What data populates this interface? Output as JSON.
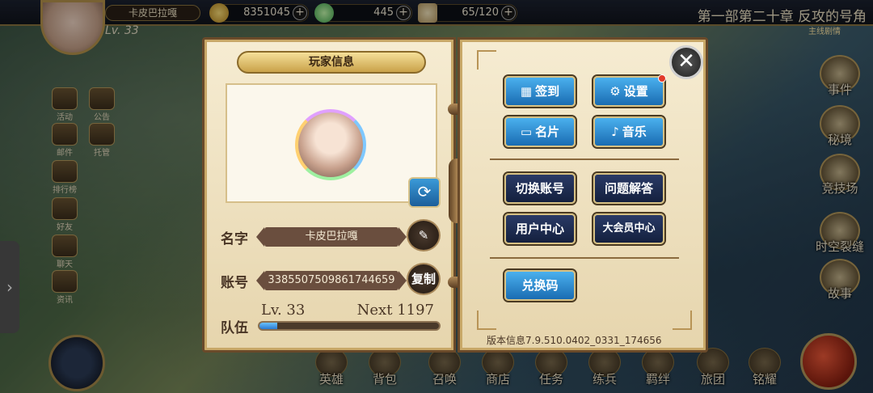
{
  "topbar": {
    "player_name": "卡皮巴拉嘎",
    "player_level": "Lv. 33",
    "gold": "8351045",
    "gems": "445",
    "stamina": "65/120",
    "chapter_title": "第一部第二十章 反攻的号角",
    "chapter_subtitle": "主线剧情"
  },
  "left_menu": [
    {
      "label": "活动"
    },
    {
      "label": "公告"
    },
    {
      "label": "邮件"
    },
    {
      "label": "托管"
    },
    {
      "label": "排行榜"
    },
    {
      "label": "好友"
    },
    {
      "label": "聊天"
    },
    {
      "label": "资讯"
    }
  ],
  "right_menu": [
    {
      "label": "事件"
    },
    {
      "label": "秘境"
    },
    {
      "label": "竞技场"
    },
    {
      "label": "时空裂缝"
    },
    {
      "label": "故事"
    }
  ],
  "bottom_nav": [
    {
      "label": "英雄"
    },
    {
      "label": "背包"
    },
    {
      "label": "召唤"
    },
    {
      "label": "商店"
    },
    {
      "label": "任务"
    },
    {
      "label": "练兵"
    },
    {
      "label": "羁绊"
    },
    {
      "label": "旅团"
    },
    {
      "label": "铭耀"
    }
  ],
  "panel": {
    "title": "玩家信息",
    "name_label": "名字",
    "name_value": "卡皮巴拉嘎",
    "account_label": "账号",
    "account_value": "3385507509861744659",
    "copy_label": "复制",
    "team_label": "队伍",
    "team_level": "Lv. 33",
    "next_label": "Next",
    "next_value": "1197",
    "xp_progress": 0.1,
    "version": "版本信息7.9.510.0402_0331_174656",
    "buttons": {
      "checkin": "签到",
      "settings": "设置",
      "card": "名片",
      "music": "音乐",
      "switch_account": "切换账号",
      "faq": "问题解答",
      "user_center": "用户中心",
      "vip_center": "大会员中心",
      "redeem": "兑换码"
    }
  },
  "colors": {
    "accent_blue": "#1a6cb2",
    "panel_bg": "#f6ecd2",
    "frame_brown": "#6a4a2a",
    "notification_red": "#e23a2a"
  }
}
